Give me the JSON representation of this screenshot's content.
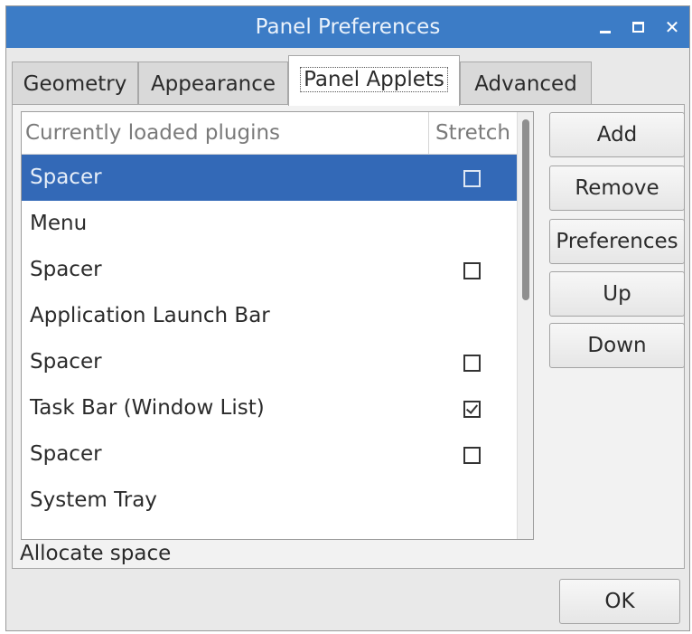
{
  "window": {
    "title": "Panel Preferences",
    "accent_color": "#3c7cc6",
    "controls": {
      "minimize_icon": "minimize-icon",
      "maximize_icon": "maximize-icon",
      "close_icon": "close-icon",
      "close_glyph": "✕"
    }
  },
  "tabs": [
    {
      "label": "Geometry",
      "active": false
    },
    {
      "label": "Appearance",
      "active": false
    },
    {
      "label": "Panel Applets",
      "active": true
    },
    {
      "label": "Advanced",
      "active": false
    }
  ],
  "plugins": {
    "columns": {
      "name": "Currently loaded plugins",
      "stretch": "Stretch"
    },
    "rows": [
      {
        "name": "Spacer",
        "stretch": false,
        "has_stretch": true,
        "selected": true
      },
      {
        "name": "Menu",
        "has_stretch": false,
        "selected": false
      },
      {
        "name": "Spacer",
        "stretch": false,
        "has_stretch": true,
        "selected": false
      },
      {
        "name": "Application Launch Bar",
        "has_stretch": false,
        "selected": false
      },
      {
        "name": "Spacer",
        "stretch": false,
        "has_stretch": true,
        "selected": false
      },
      {
        "name": "Task Bar (Window List)",
        "stretch": true,
        "has_stretch": true,
        "selected": false
      },
      {
        "name": "Spacer",
        "stretch": false,
        "has_stretch": true,
        "selected": false
      },
      {
        "name": "System Tray",
        "has_stretch": false,
        "selected": false
      }
    ],
    "selection_color": "#3369b7"
  },
  "buttons": {
    "add": "Add",
    "remove": "Remove",
    "preferences": "Preferences",
    "up": "Up",
    "down": "Down"
  },
  "status": "Allocate space",
  "ok": "OK"
}
